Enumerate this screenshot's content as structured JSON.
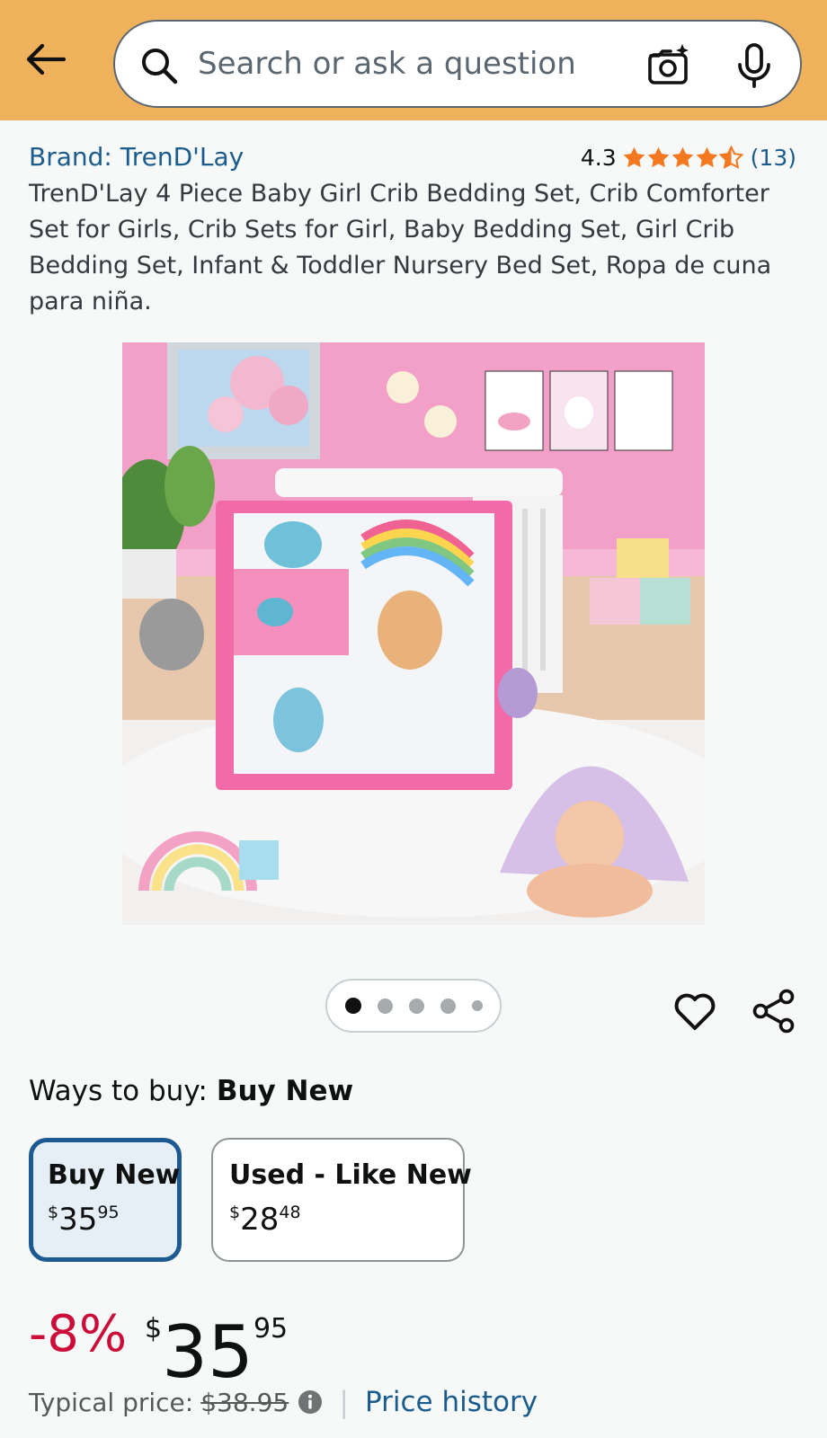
{
  "header": {
    "search_placeholder": "Search or ask a question"
  },
  "product": {
    "brand": "Brand: TrenD'Lay",
    "rating": "4.3",
    "review_count": "(13)",
    "title": "TrenD'Lay 4 Piece Baby Girl Crib Bedding Set, Crib Comforter Set for Girls, Crib Sets for Girl, Baby Bedding Set, Girl Crib Bedding Set, Infant & Toddler Nursery Bed Set, Ropa de cuna para niña.",
    "image_dots_total": 5,
    "image_dot_active": 1
  },
  "ways_to_buy": {
    "label": "Ways to buy:",
    "selected": "Buy New",
    "options": [
      {
        "label": "Buy New",
        "currency": "$",
        "whole": "35",
        "fraction": "95"
      },
      {
        "label": "Used - Like New",
        "currency": "$",
        "whole": "28",
        "fraction": "48"
      }
    ]
  },
  "price": {
    "discount": "-8%",
    "currency": "$",
    "whole": "35",
    "fraction": "95",
    "typical_label": "Typical price:",
    "typical_value": "$38.95",
    "history_link": "Price history"
  },
  "colors": {
    "header_bg": "#f0b15c",
    "link": "#1a5c8d",
    "discount": "#cc0c39",
    "star": "#f3781f"
  }
}
